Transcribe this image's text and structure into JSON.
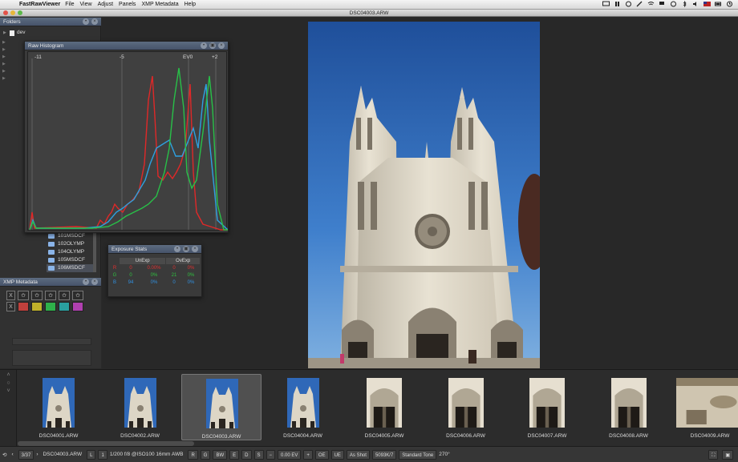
{
  "menubar": {
    "app_name": "FastRawViewer",
    "menus": [
      "File",
      "View",
      "Adjust",
      "Panels",
      "XMP Metadata",
      "Help"
    ]
  },
  "window": {
    "title": "DSC04003.ARW"
  },
  "folders_panel": {
    "title": "Folders",
    "root": "dev",
    "subfolders": [
      "101MSDCF",
      "102OLYMP",
      "104OLYMP",
      "105MSDCF",
      "106MSDCF"
    ],
    "selected": "106MSDCF"
  },
  "histogram_panel": {
    "title": "Raw Histogram",
    "scale_labels": [
      "-11",
      "-5",
      "EV0",
      "+2"
    ]
  },
  "exposure_stats": {
    "title": "Exposure Stats",
    "col_headers": [
      "UnExp",
      "OvExp"
    ],
    "rows": [
      {
        "channel": "R",
        "values": [
          "0",
          "0.00%",
          "0",
          "0%"
        ],
        "color": "#e03030"
      },
      {
        "channel": "G",
        "values": [
          "0",
          "0%",
          "21",
          "0%"
        ],
        "color": "#30c040"
      },
      {
        "channel": "B",
        "values": [
          "94",
          "0%",
          "0",
          "0%"
        ],
        "color": "#3090e0"
      }
    ]
  },
  "xmp_panel": {
    "title": "XMP Metadata",
    "reject_label": "X",
    "stars": [
      "✩",
      "✩",
      "✩",
      "✩",
      "✩"
    ],
    "color_labels": [
      "#c0403c",
      "#c0b02a",
      "#2eb04a",
      "#2aa0a0",
      "#b040b0"
    ]
  },
  "filmstrip": {
    "thumbs": [
      {
        "label": "DSC04001.ARW",
        "kind": "cathedral"
      },
      {
        "label": "DSC04002.ARW",
        "kind": "cathedral"
      },
      {
        "label": "DSC04003.ARW",
        "kind": "cathedral"
      },
      {
        "label": "DSC04004.ARW",
        "kind": "cathedral"
      },
      {
        "label": "DSC04005.ARW",
        "kind": "portal"
      },
      {
        "label": "DSC04006.ARW",
        "kind": "portal"
      },
      {
        "label": "DSC04007.ARW",
        "kind": "portal"
      },
      {
        "label": "DSC04008.ARW",
        "kind": "portal"
      },
      {
        "label": "DSC04009.ARW",
        "kind": "detail"
      }
    ],
    "active_index": 2
  },
  "statusbar": {
    "counter": "3/37",
    "filename": "DSC04003.ARW",
    "channel_1": "L",
    "channel_2": "1",
    "exif": "1/200 f/8 @ISO100 16mm AWB",
    "view_buttons": [
      "R",
      "G",
      "B",
      "BW",
      "E",
      "D",
      "S"
    ],
    "ev": "0.00 EV",
    "oe": "OE",
    "ue": "UE",
    "wb": "As Shot",
    "wb_value": "5093K/7",
    "tone": "Standard Tone",
    "rotation": "270°"
  }
}
